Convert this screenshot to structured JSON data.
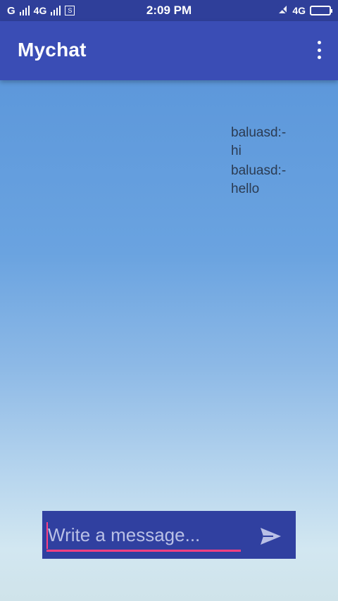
{
  "status_bar": {
    "carrier_left": "G",
    "network_2": "4G",
    "sim_label": "S",
    "time": "2:09 PM",
    "network_right": "4G",
    "icons": [
      "signal-icon",
      "sim-icon",
      "mute-icon",
      "battery-icon"
    ]
  },
  "app_bar": {
    "title": "Mychat",
    "menu_icon": "overflow-menu-icon"
  },
  "messages": [
    {
      "line1": "baluasd:-",
      "line2": "hi"
    },
    {
      "line1": "baluasd:-",
      "line2": "hello"
    }
  ],
  "composer": {
    "placeholder": "Write a message...",
    "value": "",
    "send_icon": "send-icon"
  },
  "colors": {
    "status_bar": "#2f3f9a",
    "app_bar": "#3a4db5",
    "composer": "#3040a0",
    "accent": "#ff4081"
  }
}
